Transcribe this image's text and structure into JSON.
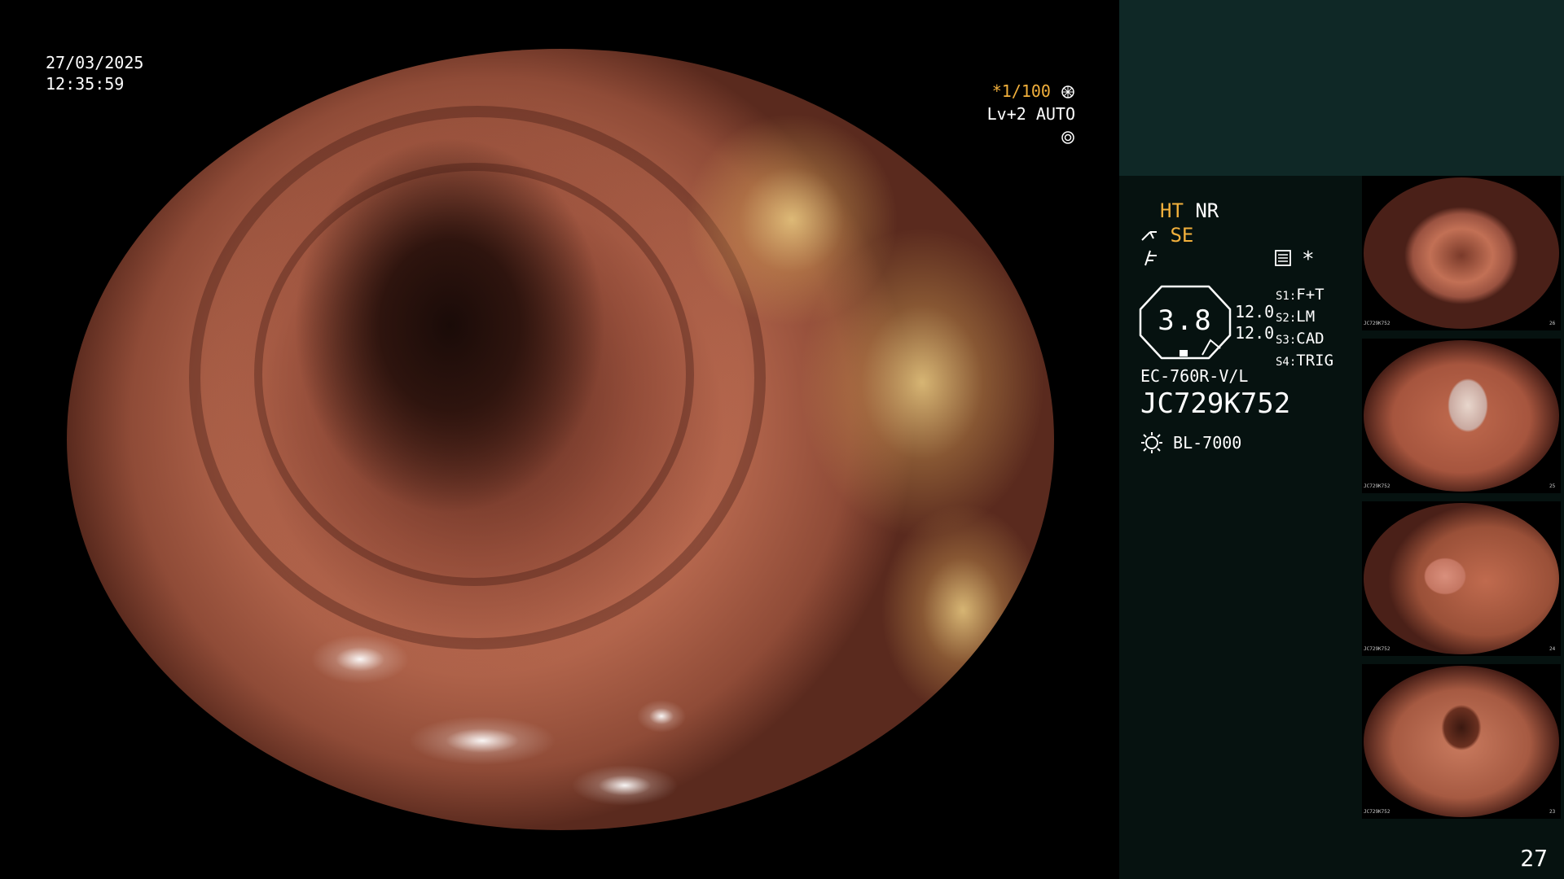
{
  "screen": {
    "date": "27/03/2025",
    "time": "12:35:59",
    "shutter": "*1/100",
    "level": "Lv+2 AUTO",
    "page_number": "27"
  },
  "hud": {
    "ht": "HT",
    "nr": "NR",
    "se": "SE",
    "gauge_value": "3.8",
    "gauge_right_1": "12.0",
    "gauge_right_2": "12.0",
    "switches": [
      {
        "key": "S1:",
        "value": "F+T"
      },
      {
        "key": "S2:",
        "value": "LM"
      },
      {
        "key": "S3:",
        "value": "CAD"
      },
      {
        "key": "S4:",
        "value": "TRIG"
      }
    ],
    "scope_model": "EC-760R-V/L",
    "serial": "JC729K752",
    "light_source": "BL-7000",
    "asterisk": "*"
  },
  "thumbnails": [
    {
      "label": "JC729K752",
      "index": "26"
    },
    {
      "label": "JC729K752",
      "index": "25"
    },
    {
      "label": "JC729K752",
      "index": "24"
    },
    {
      "label": "JC729K752",
      "index": "23"
    }
  ],
  "colors": {
    "accent_orange": "#f2b03c",
    "panel_bg": "#061210",
    "panel_band": "#0f2826"
  },
  "icons": [
    "aperture-icon",
    "auto-icon",
    "scissors-icon",
    "curve-icon",
    "menu-icon",
    "lamp-icon"
  ]
}
